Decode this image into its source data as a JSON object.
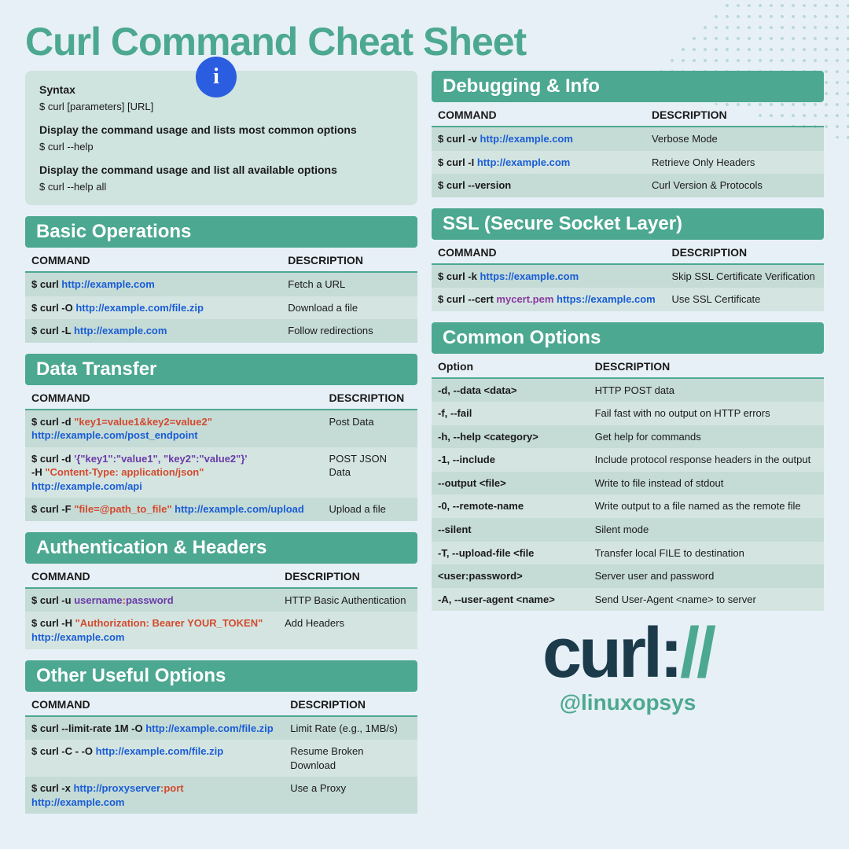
{
  "title": "Curl Command Cheat Sheet",
  "syntax": {
    "label": "Syntax",
    "code": "$ curl [parameters] [URL]",
    "h1": "Display the command usage and lists most common options",
    "c1": "$ curl --help",
    "h2": "Display the command usage and list all available options",
    "c2": "$ curl --help all"
  },
  "headers": {
    "cmd": "COMMAND",
    "desc": "DESCRIPTION",
    "opt": "Option"
  },
  "basic": {
    "title": "Basic Operations",
    "rows": [
      {
        "pre": "$ curl ",
        "url": "http://example.com",
        "desc": "Fetch a URL"
      },
      {
        "pre": "$  curl -O ",
        "url": "http://example.com/file.zip",
        "desc": "Download a file"
      },
      {
        "pre": "$  curl -L ",
        "url": "http://example.com",
        "desc": "Follow redirections"
      }
    ]
  },
  "data": {
    "title": "Data Transfer",
    "r1": {
      "pre": "$  curl -d ",
      "q": "\"key1=value1&key2=value2\"",
      "url": "http://example.com/post_endpoint",
      "desc": "Post Data"
    },
    "r2": {
      "pre": "$  curl -d ",
      "q": "'{\"key1\":\"value1\", \"key2\":\"value2\"}'",
      "h": "-H ",
      "ct": "\"Content-Type: application/json\" ",
      "url": "http://example.com/api",
      "desc": "POST JSON Data"
    },
    "r3": {
      "pre": "$   curl -F ",
      "q": "\"file=@path_to_file\" ",
      "url": "http://example.com/upload",
      "desc": "Upload a file"
    }
  },
  "auth": {
    "title": "Authentication & Headers",
    "r1": {
      "pre": "$  curl -u ",
      "u": "username",
      "c": ":",
      "p": "password",
      "desc": "HTTP Basic Authentication"
    },
    "r2": {
      "pre": "$  curl -H ",
      "q": "\"Authorization: Bearer YOUR_TOKEN\"",
      "url": "http://example.com",
      "desc": "Add Headers"
    }
  },
  "other": {
    "title": "Other Useful Options",
    "r1": {
      "pre": "$  curl --limit-rate 1M -O ",
      "url": "http://example.com/file.zip",
      "desc": "Limit Rate (e.g., 1MB/s)"
    },
    "r2": {
      "pre": "$ curl -C - -O ",
      "url": "http://example.com/file.zip",
      "desc": "Resume Broken Download"
    },
    "r3": {
      "pre": "$  curl -x ",
      "url1": "http://proxyserver",
      "port": ":port ",
      "url2": "http://example.com",
      "desc": "Use a Proxy"
    }
  },
  "debug": {
    "title": "Debugging & Info",
    "rows": [
      {
        "pre": "$ curl -v ",
        "url": "http://example.com",
        "desc": "Verbose Mode"
      },
      {
        "pre": "$ curl -I ",
        "url": "http://example.com",
        "desc": "Retrieve Only Headers"
      },
      {
        "pre": "$  curl --version",
        "url": "",
        "desc": "Curl Version & Protocols"
      }
    ]
  },
  "ssl": {
    "title": "SSL (Secure Socket Layer)",
    "r1": {
      "pre": "$ curl -k ",
      "url": "https://example.com",
      "desc": "Skip SSL Certificate Verification"
    },
    "r2": {
      "pre": "$  curl --cert ",
      "cert": "mycert.pem ",
      "url": "https://example.com",
      "desc": "Use SSL Certificate"
    }
  },
  "common": {
    "title": "Common Options",
    "rows": [
      {
        "o": "-d, --data <data>",
        "d": "HTTP POST data"
      },
      {
        "o": "-f, --fail",
        "d": "Fail fast with no output on HTTP errors"
      },
      {
        "o": "-h, --help <category>",
        "d": "Get help for commands"
      },
      {
        "o": "-1, --include",
        "d": "Include protocol response headers in the output"
      },
      {
        "o": "--output <file>",
        "d": "Write to file instead of stdout"
      },
      {
        "o": "-0, --remote-name",
        "d": "Write output to a file named as the remote file"
      },
      {
        "o": "--silent",
        "d": "Silent mode"
      },
      {
        "o": "-T, --upload-file <file",
        "d": "Transfer local FILE to destination"
      },
      {
        "o": "<user:password>",
        "d": "Server user and password"
      },
      {
        "o": "-A, --user-agent <name>",
        "d": "Send User-Agent <name> to server"
      }
    ]
  },
  "logo": {
    "text": "curl",
    "colon": ":",
    "slash": "//"
  },
  "attribution": "@linuxopsys"
}
